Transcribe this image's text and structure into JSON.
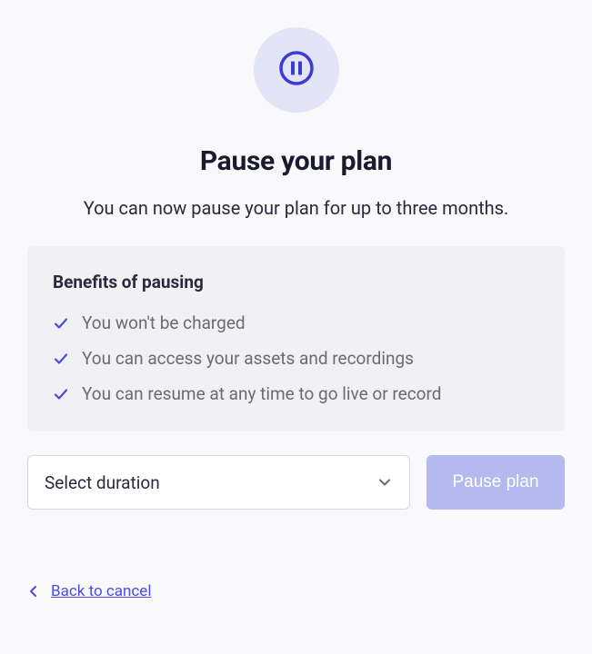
{
  "header": {
    "title": "Pause your plan",
    "subtitle": "You can now pause your plan for up to three months."
  },
  "benefits": {
    "title": "Benefits of pausing",
    "items": [
      "You won't be charged",
      "You can access your assets and recordings",
      "You can resume at any time to go live or record"
    ]
  },
  "actions": {
    "duration_placeholder": "Select duration",
    "pause_button_label": "Pause plan",
    "back_link_label": "Back to cancel"
  },
  "colors": {
    "accent": "#3b3bd6",
    "icon_bg": "#e3e4f6",
    "button_disabled": "#b4b9ee"
  }
}
